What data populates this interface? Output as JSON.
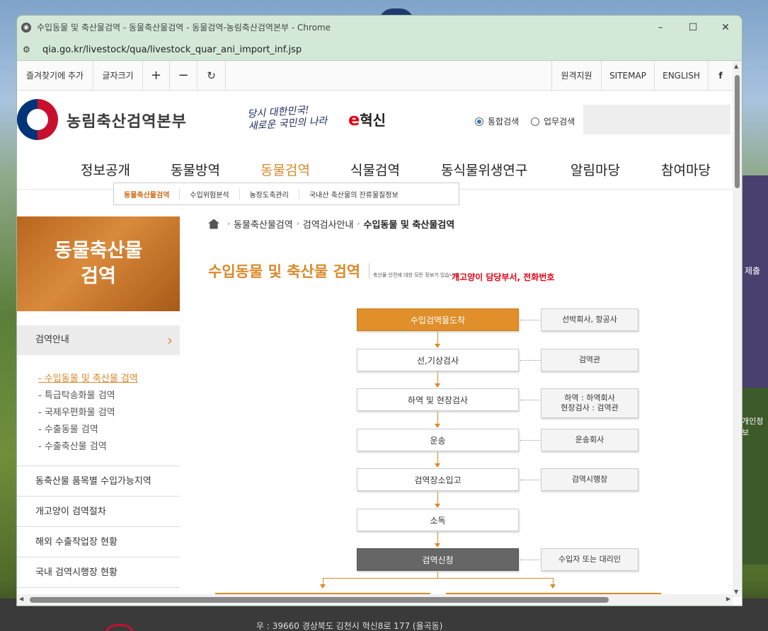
{
  "browser": {
    "title": "수입동물 및 축산물검역 - 동물축산물검역 - 동물검역-농림축산검역본부 - Chrome",
    "url": "qia.go.kr/livestock/qua/livestock_quar_ani_import_inf.jsp"
  },
  "util": {
    "bookmark": "즐겨찾기에 추가",
    "fontsize": "글자크기",
    "plus": "+",
    "minus": "−",
    "reset": "↻",
    "remote": "원격지원",
    "sitemap": "SITEMAP",
    "english": "ENGLISH",
    "facebook": "f"
  },
  "header": {
    "org_name": "농림축산검역본부",
    "slogan_line1": "당시 대한민국!",
    "slogan_line2": "새로운 국민의 나라",
    "innovation_e": "e",
    "innovation_text": "혁신",
    "search_opt1": "통합검색",
    "search_opt2": "업무검색"
  },
  "nav": {
    "items": [
      "정보공개",
      "동물방역",
      "동물검역",
      "식물검역",
      "동식물위생연구",
      "알림마당",
      "참여마당"
    ],
    "sub": [
      "동물축산물검역",
      "수입위험분석",
      "농장도축관리",
      "국내산 축산물의 잔류물질정보"
    ]
  },
  "side": {
    "banner_l1": "동물축산물",
    "banner_l2": "검역",
    "head": "검역안내",
    "sub": [
      "수입동물 및 축산물 검역",
      "특급탁송화물 검역",
      "국제우편화물 검역",
      "수출동물 검역",
      "수출축산물 검역"
    ],
    "items": [
      "동축산물 품목별 수입가능지역",
      "개고양이 검역절차",
      "해외 수출작업장 현황",
      "국내 검역시행장 현황"
    ]
  },
  "main": {
    "crumb": [
      "동물축산물검역",
      "검역검사안내",
      "수입동물 및 축산물검역"
    ],
    "title": "수입동물 및 축산물 검역",
    "note": "축산물 안전에 대한 모든 정보가 있습니다.",
    "red_note": "개고양이 담당부서, 전화번호"
  },
  "flow": {
    "steps": [
      "수입검역물도착",
      "선,기상검사",
      "하역 및 현장검사",
      "운송",
      "검역장소입고",
      "소독",
      "검역신청"
    ],
    "sides": [
      "선박회사, 항공사",
      "검역관",
      "하역 : 하역회사",
      "현장검사 : 검역관",
      "운송회사",
      "검역시행장",
      "수입자 또는 대리인"
    ]
  },
  "backdrop": {
    "right1": "제출",
    "right2": "개인정보",
    "footer_addr": "우 : 39660 경상북도 김천시 혁신8로 177 (율곡동)"
  }
}
